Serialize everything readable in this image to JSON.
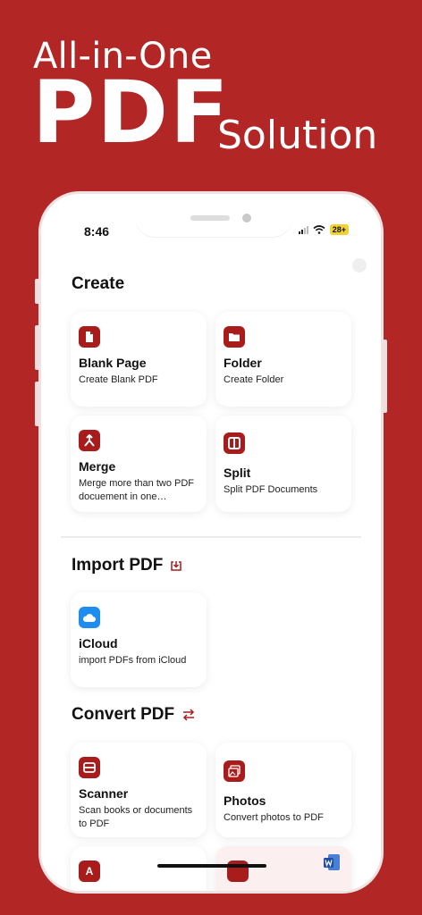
{
  "promo": {
    "line1": "All-in-One",
    "line2": "PDF",
    "line3": "Solution"
  },
  "status": {
    "time": "8:46",
    "battery": "28+"
  },
  "sections": {
    "create": "Create",
    "import": "Import PDF",
    "convert": "Convert PDF"
  },
  "cards": {
    "blank": {
      "title": "Blank Page",
      "sub": "Create Blank PDF"
    },
    "folder": {
      "title": "Folder",
      "sub": "Create Folder"
    },
    "merge": {
      "title": "Merge",
      "sub": "Merge more than two PDF docuement in one…"
    },
    "split": {
      "title": "Split",
      "sub": "Split PDF Documents"
    },
    "icloud": {
      "title": "iCloud",
      "sub": "import PDFs from iCloud"
    },
    "scanner": {
      "title": "Scanner",
      "sub": "Scan books or documents to PDF"
    },
    "photos": {
      "title": "Photos",
      "sub": "Convert photos to PDF"
    }
  },
  "colors": {
    "brand_red": "#b22625",
    "icon_red": "#a81d1c",
    "icloud_blue": "#1f8cf0"
  },
  "icons": [
    "file-icon",
    "folder-icon",
    "merge-icon",
    "split-icon",
    "import-icon",
    "cloud-icon",
    "convert-icon",
    "scanner-icon",
    "photos-icon",
    "text-icon",
    "word-icon"
  ]
}
